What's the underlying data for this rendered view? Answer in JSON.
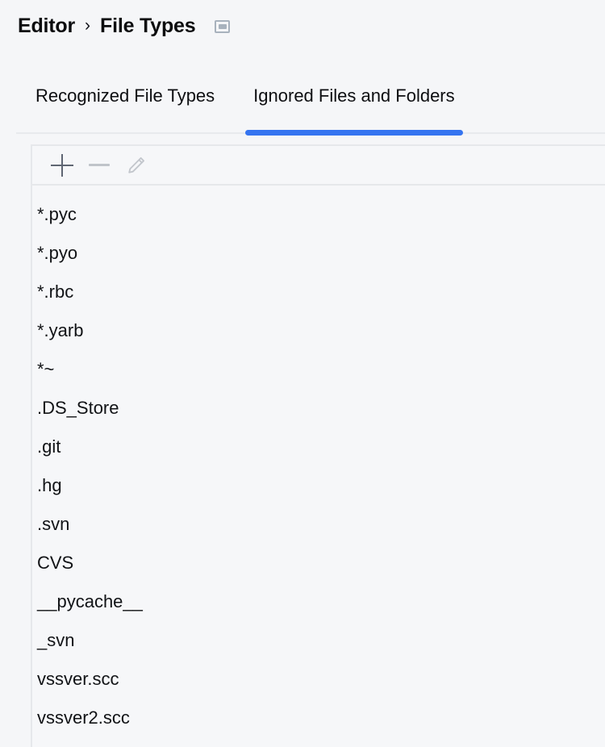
{
  "header": {
    "breadcrumb": {
      "root": "Editor",
      "separator": "›",
      "current": "File Types"
    },
    "panel_icon": "panel-layout-icon"
  },
  "tabs": [
    {
      "label": "Recognized File Types",
      "active": false
    },
    {
      "label": "Ignored Files and Folders",
      "active": true
    }
  ],
  "toolbar": {
    "add_label": "+",
    "remove_label": "−",
    "edit_label": "✎",
    "icons": [
      "plus-icon",
      "minus-icon",
      "pencil-icon"
    ]
  },
  "list": {
    "items": [
      "*.pyc",
      "*.pyo",
      "*.rbc",
      "*.yarb",
      "*~",
      ".DS_Store",
      ".git",
      ".hg",
      ".svn",
      "CVS",
      "__pycache__",
      "_svn",
      "vssver.scc",
      "vssver2.scc"
    ]
  },
  "colors": {
    "background": "#f5f6f8",
    "panel_background": "#f6f7f9",
    "accent": "#3574f0",
    "border": "#e6e8eb",
    "tab_border": "#e8eaed",
    "text": "#111316",
    "icon_enabled": "#5f6673",
    "icon_disabled": "#c2c6cc",
    "header_icon": "#a8b2bd"
  }
}
